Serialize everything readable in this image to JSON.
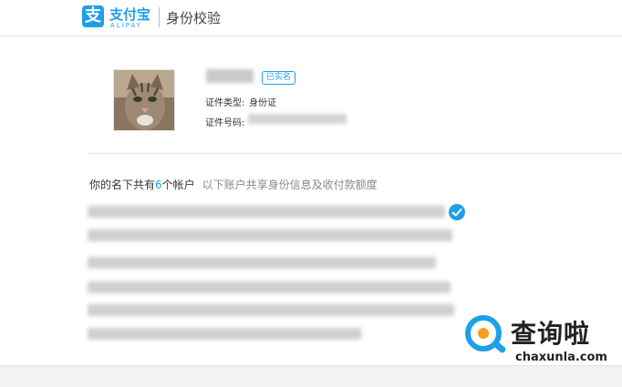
{
  "header": {
    "logo_glyph": "支",
    "logo_cn": "支付宝",
    "logo_en": "ALIPAY",
    "page_title": "身份校验"
  },
  "profile": {
    "verified_badge": "已实名",
    "id_type_label": "证件类型:",
    "id_type_value": "身份证",
    "id_number_label": "证件号码:"
  },
  "accounts": {
    "title_prefix": "你的名下共有",
    "count": "6",
    "title_suffix": "个帐户",
    "note": "以下账户共享身份信息及收付款额度"
  },
  "watermark": {
    "brand_cn": "查询啦",
    "url": "chaxunla.com"
  },
  "colors": {
    "accent": "#1f9fe8",
    "watermark_orange": "#ff9b1a"
  }
}
